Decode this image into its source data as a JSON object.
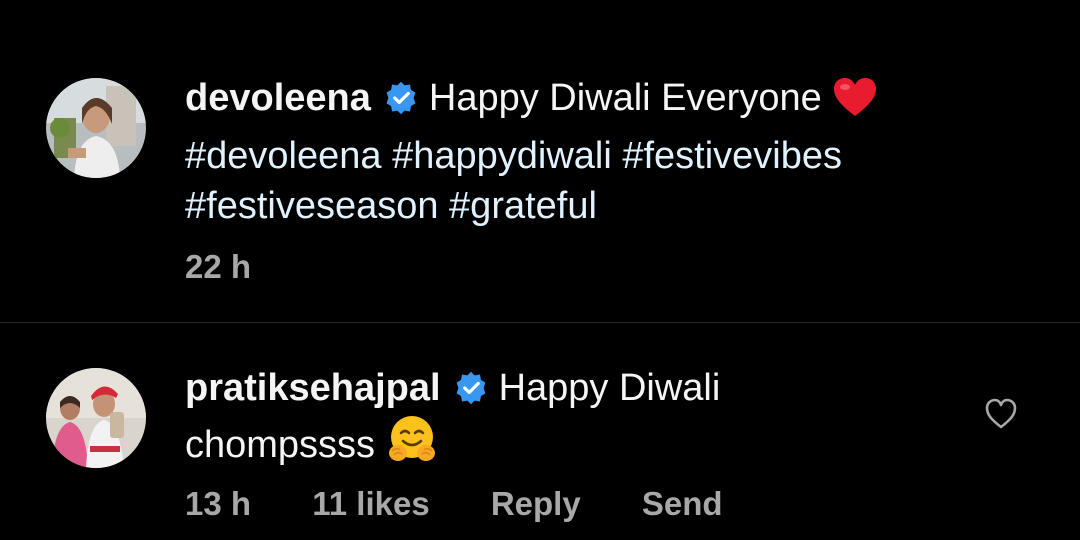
{
  "comments": [
    {
      "username": "devoleena",
      "verified": true,
      "text": "Happy Diwali Everyone",
      "emoji": "red-heart",
      "hashtags_line1": "#devoleena #happydiwali #festivevibes",
      "hashtags_line2": "#festiveseason #grateful",
      "time": "22 h"
    },
    {
      "username": "pratiksehajpal",
      "verified": true,
      "text_line1": "Happy Diwali",
      "text_line2": "chompssss",
      "emoji": "hugging-face",
      "time": "13 h",
      "likes": "11 likes",
      "reply_label": "Reply",
      "send_label": "Send"
    }
  ],
  "colors": {
    "background": "#000000",
    "text": "#f5f5f5",
    "meta": "#a8a8a8",
    "verified_badge": "#3897f0",
    "divider": "#262626"
  }
}
